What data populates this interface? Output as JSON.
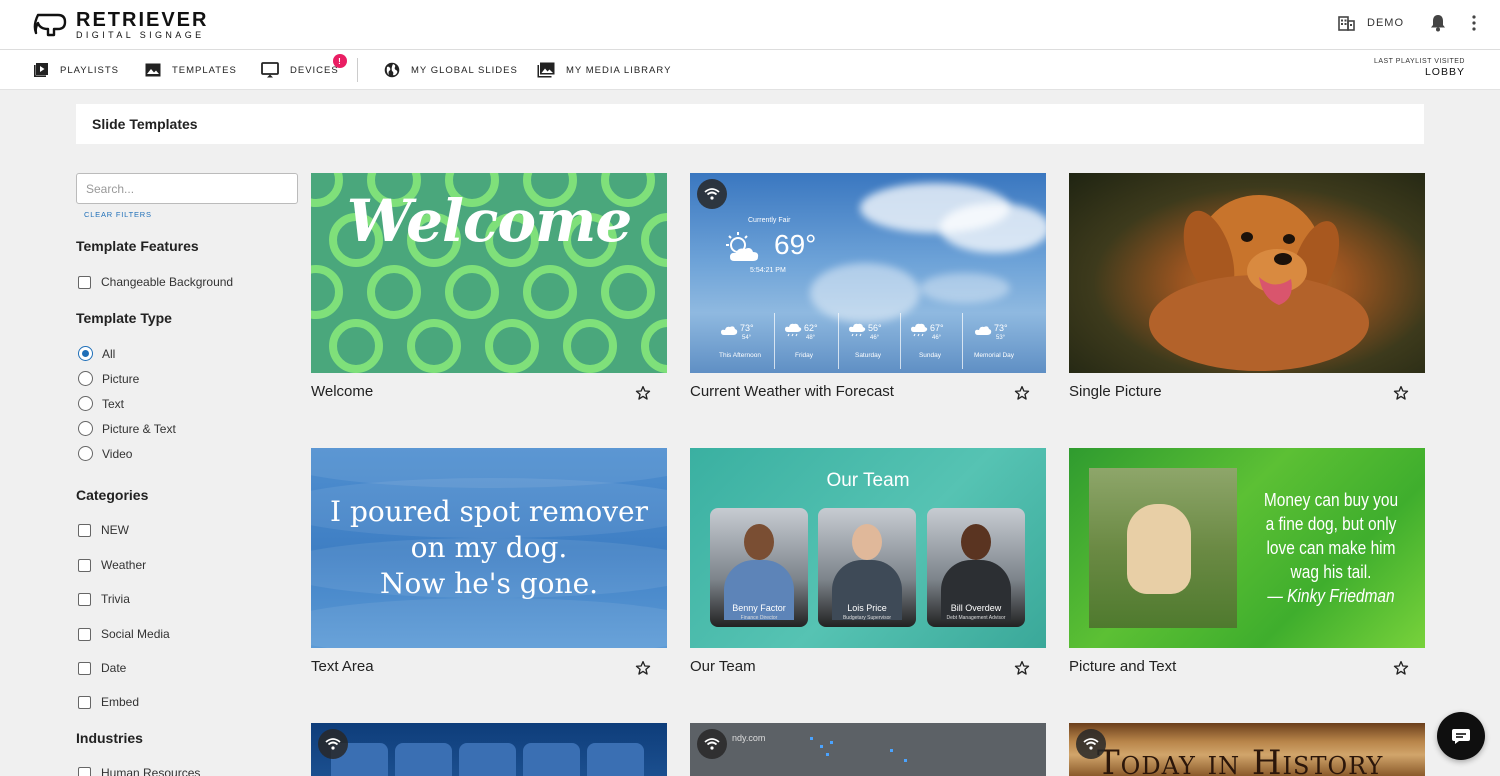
{
  "brand": {
    "title": "RETRIEVER",
    "subtitle": "DIGITAL SIGNAGE"
  },
  "header": {
    "org_name": "DEMO",
    "icons": [
      "building-icon",
      "bell-icon",
      "more-vert-icon"
    ]
  },
  "nav": {
    "items": [
      {
        "label": "PLAYLISTS",
        "icon": "playlist-icon"
      },
      {
        "label": "TEMPLATES",
        "icon": "image-icon"
      },
      {
        "label": "DEVICES",
        "icon": "monitor-icon",
        "badge": "!"
      },
      {
        "label": "MY GLOBAL SLIDES",
        "icon": "globe-icon"
      },
      {
        "label": "MY MEDIA LIBRARY",
        "icon": "media-library-icon"
      }
    ],
    "last_visited_label": "LAST PLAYLIST VISITED",
    "last_visited_value": "LOBBY"
  },
  "page": {
    "title": "Slide Templates"
  },
  "sidebar": {
    "search_placeholder": "Search...",
    "clear_filters": "CLEAR FILTERS",
    "features_title": "Template Features",
    "features": [
      "Changeable Background"
    ],
    "type_title": "Template Type",
    "types": [
      "All",
      "Picture",
      "Text",
      "Picture & Text",
      "Video"
    ],
    "selected_type": "All",
    "categories_title": "Categories",
    "categories": [
      "NEW",
      "Weather",
      "Trivia",
      "Social Media",
      "Date",
      "Embed"
    ],
    "industries_title": "Industries",
    "industries": [
      "Human Resources"
    ]
  },
  "cards": [
    {
      "title": "Welcome",
      "thumb_text": "Welcome"
    },
    {
      "title": "Current Weather with Forecast",
      "weather": {
        "label": "Currently Fair",
        "temp": "69°",
        "time": "5:54:21 PM",
        "forecast": [
          {
            "hi": "73°",
            "lo": "54°",
            "day": "This Afternoon"
          },
          {
            "hi": "62°",
            "lo": "48°",
            "day": "Friday"
          },
          {
            "hi": "56°",
            "lo": "46°",
            "day": "Saturday"
          },
          {
            "hi": "67°",
            "lo": "46°",
            "day": "Sunday"
          },
          {
            "hi": "73°",
            "lo": "53°",
            "day": "Memorial Day"
          }
        ]
      }
    },
    {
      "title": "Single Picture"
    },
    {
      "title": "Text Area",
      "quote": [
        "I poured spot remover",
        "on my dog.",
        "Now he's gone."
      ]
    },
    {
      "title": "Our Team",
      "heading": "Our Team",
      "people": [
        {
          "name": "Benny Factor",
          "role": "Finance Director"
        },
        {
          "name": "Lois Price",
          "role": "Budgetary Supervisor"
        },
        {
          "name": "Bill Overdew",
          "role": "Debt Management Advisor"
        }
      ]
    },
    {
      "title": "Picture and Text",
      "quote": [
        "Money can buy you",
        "a fine dog, but only",
        "love can make him",
        "wag his tail."
      ],
      "author": "— Kinky Friedman"
    },
    {
      "title": "",
      "kind": "weather-icons"
    },
    {
      "title": "",
      "kind": "map",
      "map_text": "ndy.com"
    },
    {
      "title": "",
      "kind": "history",
      "thumb_text": "Today in History"
    }
  ],
  "colors": {
    "accent": "#1f6fb8",
    "badge": "#e91e63",
    "background": "#f0f0f0"
  }
}
